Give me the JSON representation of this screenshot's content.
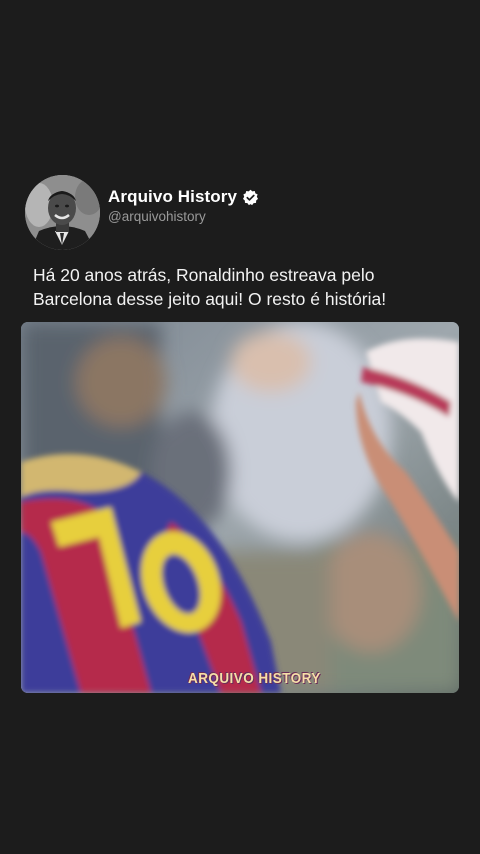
{
  "post": {
    "display_name": "Arquivo History",
    "handle": "@arquivohistory",
    "verified_icon": "verified-badge-icon",
    "text": "Há 20 anos atrás, Ronaldinho estreava pelo Barcelona desse jeito aqui! O resto é história!"
  },
  "media": {
    "watermark": "ARQUIVO HISTORY"
  },
  "colors": {
    "background": "#1c1c1c",
    "text": "#f2f2f2",
    "handle": "#9a9a9a"
  }
}
